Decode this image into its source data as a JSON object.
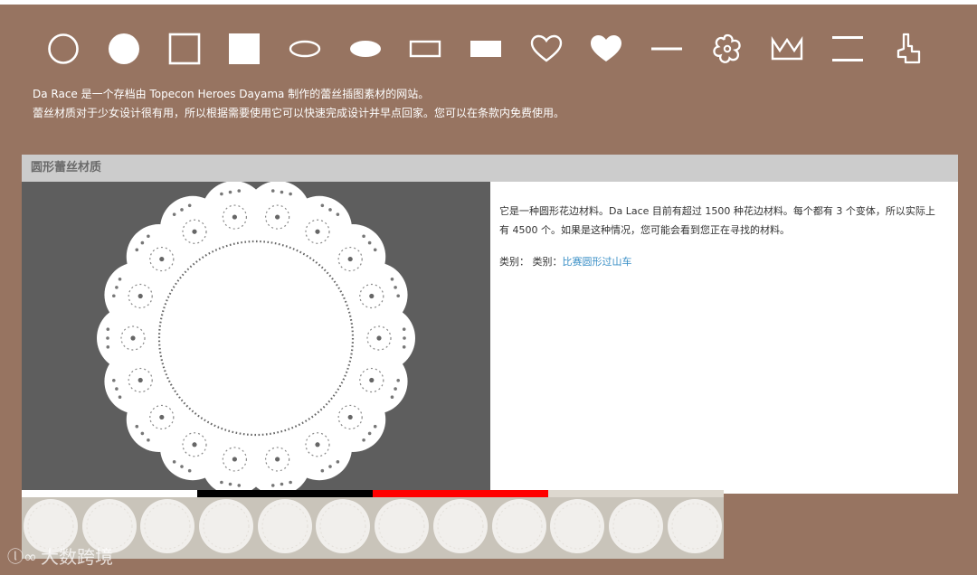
{
  "shape_nav": [
    {
      "name": "circle-outline"
    },
    {
      "name": "circle-filled"
    },
    {
      "name": "square-outline"
    },
    {
      "name": "square-filled"
    },
    {
      "name": "ellipse-outline"
    },
    {
      "name": "ellipse-filled"
    },
    {
      "name": "rectangle-outline"
    },
    {
      "name": "rectangle-filled"
    },
    {
      "name": "heart-outline"
    },
    {
      "name": "heart-filled"
    },
    {
      "name": "line"
    },
    {
      "name": "flower-outline"
    },
    {
      "name": "crown-outline"
    },
    {
      "name": "double-line"
    },
    {
      "name": "corner"
    }
  ],
  "intro": {
    "line1": "Da Race 是一个存档由 Topecon Heroes Dayama 制作的蕾丝插图素材的网站。",
    "line2": "蕾丝材质对于少女设计很有用，所以根据需要使用它可以快速完成设计并早点回家。您可以在条款内免费使用。"
  },
  "panel": {
    "title": "圆形蕾丝材质",
    "description": "它是一种圆形花边材料。Da Lace 目前有超过 1500 种花边材料。每个都有 3 个变体，所以实际上有 4500 个。如果是这种情况，您可能会看到您正在寻找的材料。",
    "category_prefix": "类别： 类别：",
    "category_link": "比赛圆形过山车"
  },
  "swatches": [
    "#ffffff",
    "#000000",
    "#ff0000",
    "#ddd8cf"
  ],
  "colors": {
    "background": "#977461",
    "header_bar": "#cccccc",
    "image_bg": "#5e5e5e",
    "link": "#3a8fc6"
  },
  "watermark": "大数跨境"
}
